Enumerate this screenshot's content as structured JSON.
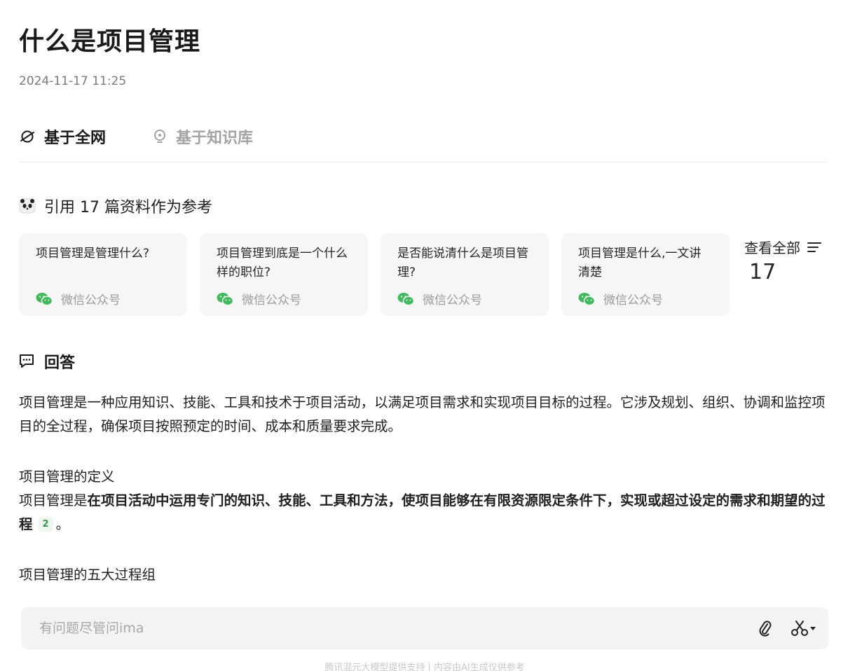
{
  "page": {
    "title": "什么是项目管理",
    "timestamp": "2024-11-17 11:25"
  },
  "tabs": [
    {
      "label": "基于全网",
      "active": true,
      "icon": "globe-orbit-icon"
    },
    {
      "label": "基于知识库",
      "active": false,
      "icon": "lightbulb-icon"
    }
  ],
  "references": {
    "heading": "引用 17 篇资料作为参考",
    "cards": [
      {
        "title": "项目管理是管理什么?",
        "source": "微信公众号"
      },
      {
        "title": "项目管理到底是一个什么样的职位?",
        "source": "微信公众号"
      },
      {
        "title": "是否能说清什么是项目管理?",
        "source": "微信公众号"
      },
      {
        "title": "项目管理是什么,一文讲清楚",
        "source": "微信公众号"
      }
    ],
    "view_all_label": "查看全部",
    "view_all_count": "17"
  },
  "answer": {
    "heading": "回答",
    "intro": "项目管理是一种应用知识、技能、工具和技术于项目活动，以满足项目需求和实现项目目标的过程。它涉及规划、组织、协调和监控项目的全过程，确保项目按照预定的时间、成本和质量要求完成。",
    "definition_heading": "项目管理的定义",
    "definition_prefix": "项目管理是",
    "definition_bold": "在项目活动中运用专门的知识、技能、工具和方法，使项目能够在有限资源限定条件下，实现或超过设定的需求和期望的过程",
    "definition_cite": "2",
    "definition_suffix": "。",
    "process_heading": "项目管理的五大过程组"
  },
  "input": {
    "placeholder": "有问题尽管问ima"
  },
  "footer": {
    "text": "腾讯混元大模型提供支持 | 内容由AI生成仅供参考"
  },
  "colors": {
    "wechat_green": "#3dbb5b",
    "card_bg": "#f6f6f6",
    "cite_green": "#2f9a4b"
  }
}
